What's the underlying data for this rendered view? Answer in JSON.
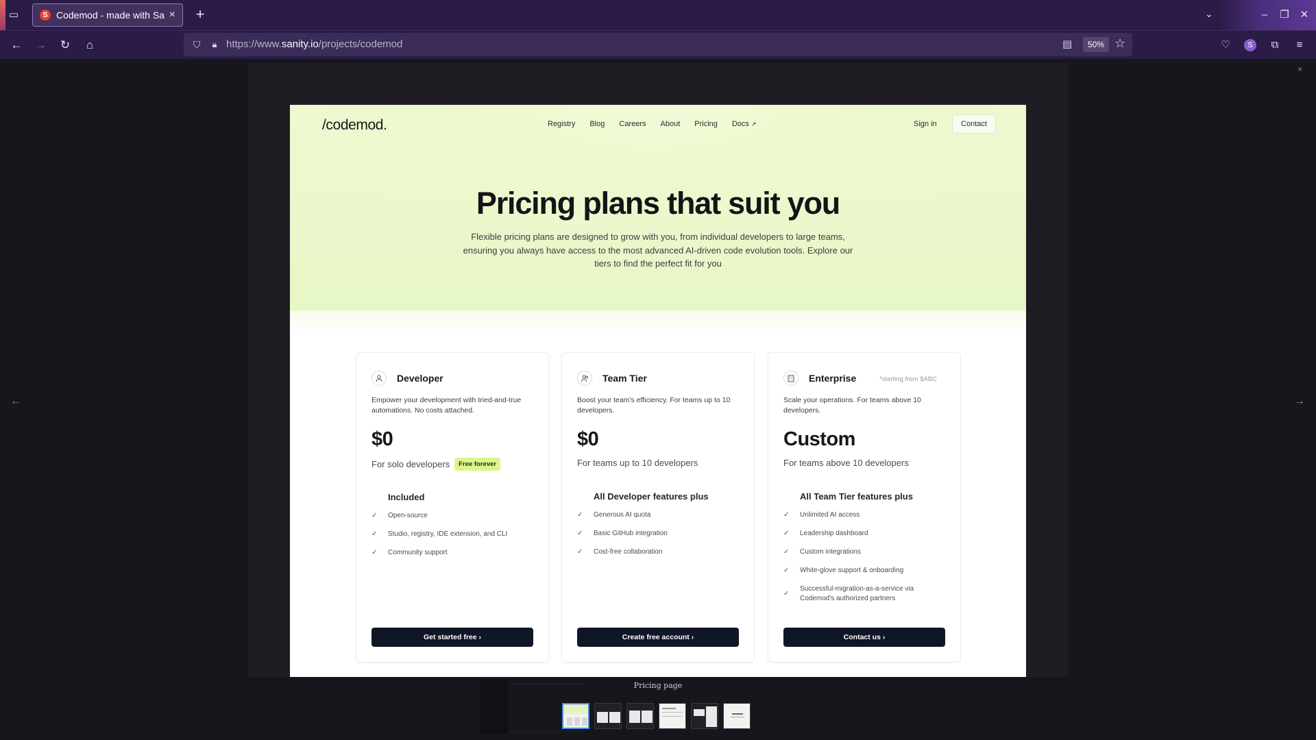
{
  "browser": {
    "tab": {
      "title": "Codemod - made with Sanity",
      "favicon_letter": "S"
    },
    "url": {
      "scheme": "https://www.",
      "host": "sanity.io",
      "path": "/projects/codemod"
    },
    "zoom": "50%",
    "profile_letter": "S",
    "colors": {
      "tabbar": "#2b1c47",
      "favicon": "#f03e2f"
    }
  },
  "viewer": {
    "caption": "Pricing page",
    "thumbnails": 6,
    "active_thumbnail": 1
  },
  "site": {
    "logo": "/codemod.",
    "nav": [
      "Registry",
      "Blog",
      "Careers",
      "About",
      "Pricing",
      "Docs"
    ],
    "docs_ext_icon": "↗",
    "sign_in": "Sign in",
    "contact": "Contact",
    "hero": {
      "title": "Pricing plans that suit you",
      "subtitle": "Flexible pricing plans are designed to grow with you, from individual developers to large teams, ensuring you always have access to the most advanced AI-driven code evolution tools. Explore our tiers to find the perfect fit for you"
    },
    "plans": [
      {
        "icon": "user-icon",
        "name": "Developer",
        "note": "",
        "description": "Empower your development with tried-and-true automations. No costs attached.",
        "price": "$0",
        "for": "For solo developers",
        "badge": "Free forever",
        "features_title": "Included",
        "features": [
          "Open-source",
          "Studio, registry, IDE extension, and CLI",
          "Community support"
        ],
        "cta": "Get started free"
      },
      {
        "icon": "team-icon",
        "name": "Team Tier",
        "note": "",
        "description": "Boost your team's efficiency. For teams up to 10 developers.",
        "price": "$0",
        "for": "For teams up to 10 developers",
        "badge": "",
        "features_title": "All Developer features plus",
        "features": [
          "Generous AI quota",
          "Basic GitHub integration",
          "Cost-free collaboration"
        ],
        "cta": "Create free account"
      },
      {
        "icon": "building-icon",
        "name": "Enterprise",
        "note": "*starting from $ABC",
        "description": "Scale your operations. For teams above 10 developers.",
        "price": "Custom",
        "for": "For teams above 10 developers",
        "badge": "",
        "features_title": "All Team Tier features plus",
        "features": [
          "Unlimited AI access",
          "Leadership dashboard",
          "Custom integrations",
          "White-glove support & onboarding",
          "Successful-migration-as-a-service via Codemod's authorized partners"
        ],
        "cta": "Contact us"
      }
    ],
    "colors": {
      "hero_tint": "#eaf7cb",
      "badge": "#dcf58d",
      "cta": "#0f1626"
    }
  }
}
